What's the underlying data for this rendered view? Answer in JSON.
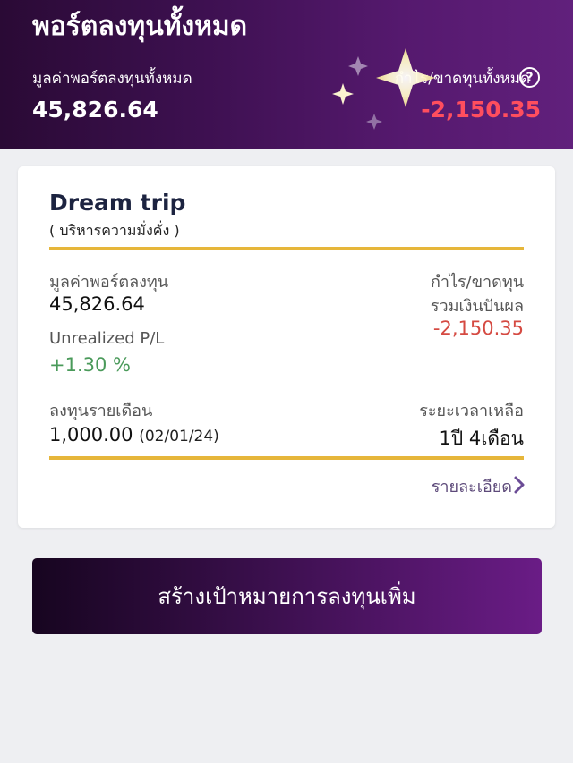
{
  "header": {
    "title": "พอร์ตลงทุนทั้งหมด",
    "total_value_label": "มูลค่าพอร์ตลงทุนทั้งหมด",
    "total_value": "45,826.64",
    "total_pl_label": "กำไร/ขาดทุนทั้งหมด",
    "total_pl": "-2,150.35",
    "info_glyph": "?"
  },
  "goal_card": {
    "title": "Dream trip",
    "subtitle": "( บริหารความมั่งคั่ง )",
    "portfolio_value_label": "มูลค่าพอร์ตลงทุน",
    "portfolio_value": "45,826.64",
    "pl_label_line1": "กำไร/ขาดทุน",
    "pl_label_line2": "รวมเงินปันผล",
    "pl_value": "-2,150.35",
    "unrealized_label": "Unrealized P/L",
    "unrealized_value": "+1.30 %",
    "monthly_label": "ลงทุนรายเดือน",
    "monthly_value": "1,000.00",
    "monthly_date": "(02/01/24)",
    "remaining_label": "ระยะเวลาเหลือ",
    "remaining_value": "1ปี 4เดือน",
    "details_link": "รายละเอียด"
  },
  "cta": {
    "label": "สร้างเป้าหมายการลงทุนเพิ่ม"
  },
  "colors": {
    "loss": "#d54a42",
    "gain": "#4a9a5a",
    "accent_gold": "#e6b63a",
    "brand_purple": "#55196e"
  },
  "icons": [
    "sparkle-icon",
    "info-icon",
    "chevron-right-icon"
  ]
}
